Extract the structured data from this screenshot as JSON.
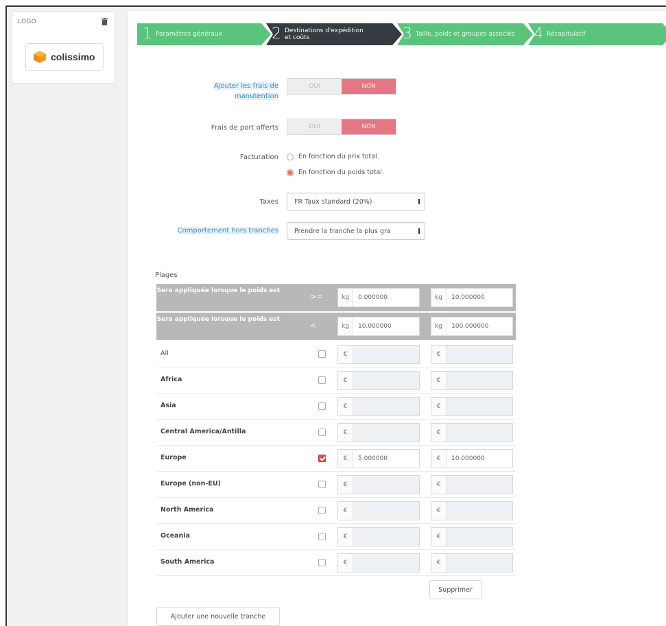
{
  "logo_panel": {
    "title": "LOGO",
    "brand_text": "colissimo"
  },
  "wizard": [
    {
      "num": "1",
      "label": "Paramètres généraux",
      "state": "done"
    },
    {
      "num": "2",
      "label": "Destinations d'expédition et coûts",
      "state": "current"
    },
    {
      "num": "3",
      "label": "Taille, poids et groupes associés",
      "state": "done"
    },
    {
      "num": "4",
      "label": "Récapitulatif",
      "state": "done"
    }
  ],
  "form": {
    "handling": {
      "label": "Ajouter les frais de manutention",
      "yes": "OUI",
      "no": "NON",
      "value": "NON"
    },
    "free_shipping": {
      "label": "Frais de port offerts",
      "yes": "OUI",
      "no": "NON",
      "value": "NON"
    },
    "billing": {
      "label": "Facturation",
      "options": [
        {
          "label": "En fonction du prix total.",
          "checked": false
        },
        {
          "label": "En fonction du poids total.",
          "checked": true
        }
      ]
    },
    "taxes": {
      "label": "Taxes",
      "value": "FR Taux standard (20%)"
    },
    "out_of_range": {
      "label": "Comportement hors tranches",
      "value": "Prendre la tranche la plus gra"
    }
  },
  "ranges": {
    "title": "Plages",
    "from_label": "Sera appliquée lorsque le poids est",
    "from_op": ">=",
    "to_label": "Sera appliquée lorsque le poids est",
    "to_op": "<",
    "unit": "kg",
    "currency": "€",
    "columns": [
      {
        "from": "0.000000",
        "to": "10.000000"
      },
      {
        "from": "10.000000",
        "to": "100.000000"
      }
    ],
    "zones": [
      {
        "name": "All",
        "bold": false,
        "checked": false,
        "values": [
          "",
          ""
        ]
      },
      {
        "name": "Africa",
        "bold": true,
        "checked": false,
        "values": [
          "",
          ""
        ]
      },
      {
        "name": "Asia",
        "bold": true,
        "checked": false,
        "values": [
          "",
          ""
        ]
      },
      {
        "name": "Central America/Antilla",
        "bold": true,
        "checked": false,
        "values": [
          "",
          ""
        ]
      },
      {
        "name": "Europe",
        "bold": true,
        "checked": true,
        "values": [
          "5.000000",
          "10.000000"
        ]
      },
      {
        "name": "Europe (non-EU)",
        "bold": true,
        "checked": false,
        "values": [
          "",
          ""
        ]
      },
      {
        "name": "North America",
        "bold": true,
        "checked": false,
        "values": [
          "",
          ""
        ]
      },
      {
        "name": "Oceania",
        "bold": true,
        "checked": false,
        "values": [
          "",
          ""
        ]
      },
      {
        "name": "South America",
        "bold": true,
        "checked": false,
        "values": [
          "",
          ""
        ]
      }
    ],
    "delete_label": "Supprimer",
    "add_label": "Ajouter une nouvelle tranche"
  },
  "colors": {
    "step_done": "#59c47a",
    "step_current": "#363a41",
    "toggle_no": "#e37884",
    "help_text": "#3b8bc2"
  }
}
